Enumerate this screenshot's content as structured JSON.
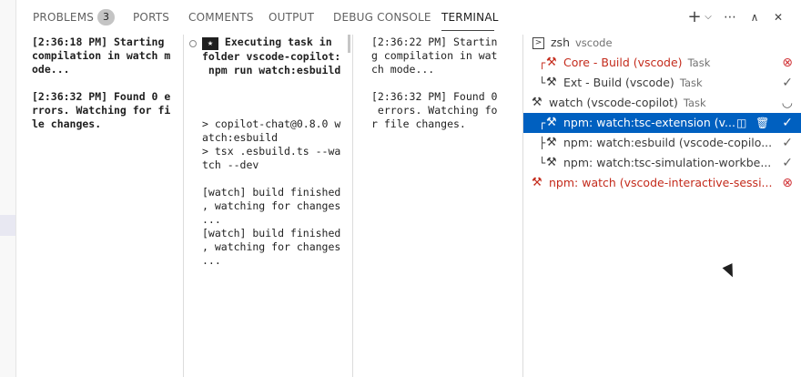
{
  "tabs": [
    {
      "label": "PROBLEMS",
      "badge": "3"
    },
    {
      "label": "PORTS"
    },
    {
      "label": "COMMENTS"
    },
    {
      "label": "OUTPUT"
    },
    {
      "label": "DEBUG CONSOLE"
    },
    {
      "label": "TERMINAL",
      "active": true
    }
  ],
  "actions": {
    "new_terminal": "+",
    "dropdown": "⌵",
    "more": "⋯",
    "maximize": "∧",
    "close": "✕"
  },
  "panes": [
    {
      "text": "[2:36:18 PM] Starting\ncompilation in watch m\node...\n\n[2:36:32 PM] Found 0 e\nrrors. Watching for fi\nle changes."
    },
    {
      "header_prefix": "★",
      "header": " Executing task in\nfolder vscode-copilot:\n npm run watch:esbuild",
      "text": "> copilot-chat@0.8.0 w\natch:esbuild\n> tsx .esbuild.ts --wa\ntch --dev\n\n[watch] build finished\n, watching for changes\n...\n[watch] build finished\n, watching for changes\n..."
    },
    {
      "text": "[2:36:22 PM] Startin\ng compilation in wat\nch mode...\n\n[2:36:32 PM] Found 0\n errors. Watching fo\nr file changes."
    }
  ],
  "terminals": [
    {
      "tree": "",
      "icon": "terminal",
      "label": "zsh",
      "suffix": "vscode",
      "status": "",
      "state": "normal"
    },
    {
      "tree": "┌",
      "icon": "tools",
      "label": "Core - Build (vscode)",
      "suffix": "Task",
      "status": "⊗",
      "state": "error"
    },
    {
      "tree": "└",
      "icon": "tools",
      "label": "Ext - Build (vscode)",
      "suffix": "Task",
      "status": "✓",
      "state": "normal"
    },
    {
      "tree": "",
      "icon": "tools",
      "label": "watch (vscode-copilot)",
      "suffix": "Task",
      "status": "◡",
      "state": "normal"
    },
    {
      "tree": "┌",
      "icon": "tools",
      "label": "npm: watch:tsc-extension (v...",
      "suffix": "",
      "status": "✓",
      "state": "selected"
    },
    {
      "tree": "├",
      "icon": "tools",
      "label": "npm: watch:esbuild (vscode-copilo...",
      "suffix": "",
      "status": "✓",
      "state": "normal"
    },
    {
      "tree": "└",
      "icon": "tools",
      "label": "npm: watch:tsc-simulation-workbe...",
      "suffix": "",
      "status": "✓",
      "state": "normal"
    },
    {
      "tree": "",
      "icon": "tools",
      "label": "npm: watch (vscode-interactive-sessi...",
      "suffix": "",
      "status": "⊗",
      "state": "error"
    }
  ],
  "selected_row_actions": {
    "split": "◫",
    "trash": "🗑"
  }
}
